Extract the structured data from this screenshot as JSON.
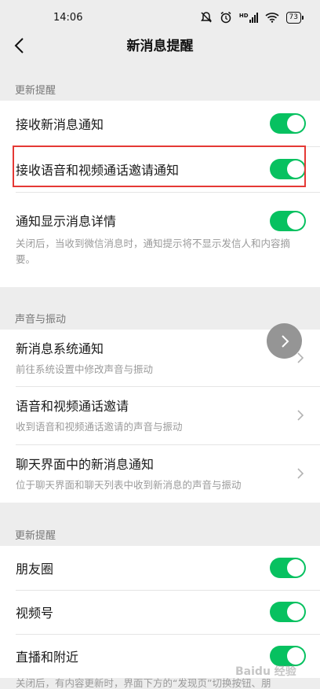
{
  "status_bar": {
    "time": "14:06",
    "signal_label": "HD",
    "battery": "73"
  },
  "nav": {
    "title": "新消息提醒"
  },
  "sections": {
    "update": {
      "label": "更新提醒",
      "items": [
        {
          "title": "接收新消息通知",
          "toggle": true
        },
        {
          "title": "接收语音和视频通话邀请通知",
          "toggle": true
        },
        {
          "title": "通知显示消息详情",
          "desc": "关闭后，当收到微信消息时，通知提示将不显示发信人和内容摘要。",
          "toggle": true
        }
      ]
    },
    "sound": {
      "label": "声音与振动",
      "items": [
        {
          "title": "新消息系统通知",
          "desc": "前往系统设置中修改声音与振动"
        },
        {
          "title": "语音和视频通话邀请",
          "desc": "收到语音和视频通话邀请的声音与振动"
        },
        {
          "title": "聊天界面中的新消息通知",
          "desc": "位于聊天界面和聊天列表中收到新消息的声音与振动"
        }
      ]
    },
    "update2": {
      "label": "更新提醒",
      "items": [
        {
          "title": "朋友圈",
          "toggle": true
        },
        {
          "title": "视频号",
          "toggle": true
        },
        {
          "title": "直播和附近",
          "toggle": true
        }
      ]
    }
  },
  "bottom_note": "关闭后，有内容更新时，界面下方的“发现页”切换按钮、朋",
  "watermark": "Baidu 经验",
  "colors": {
    "toggle_on": "#07c160",
    "highlight": "#e53935",
    "background": "#ededed"
  }
}
